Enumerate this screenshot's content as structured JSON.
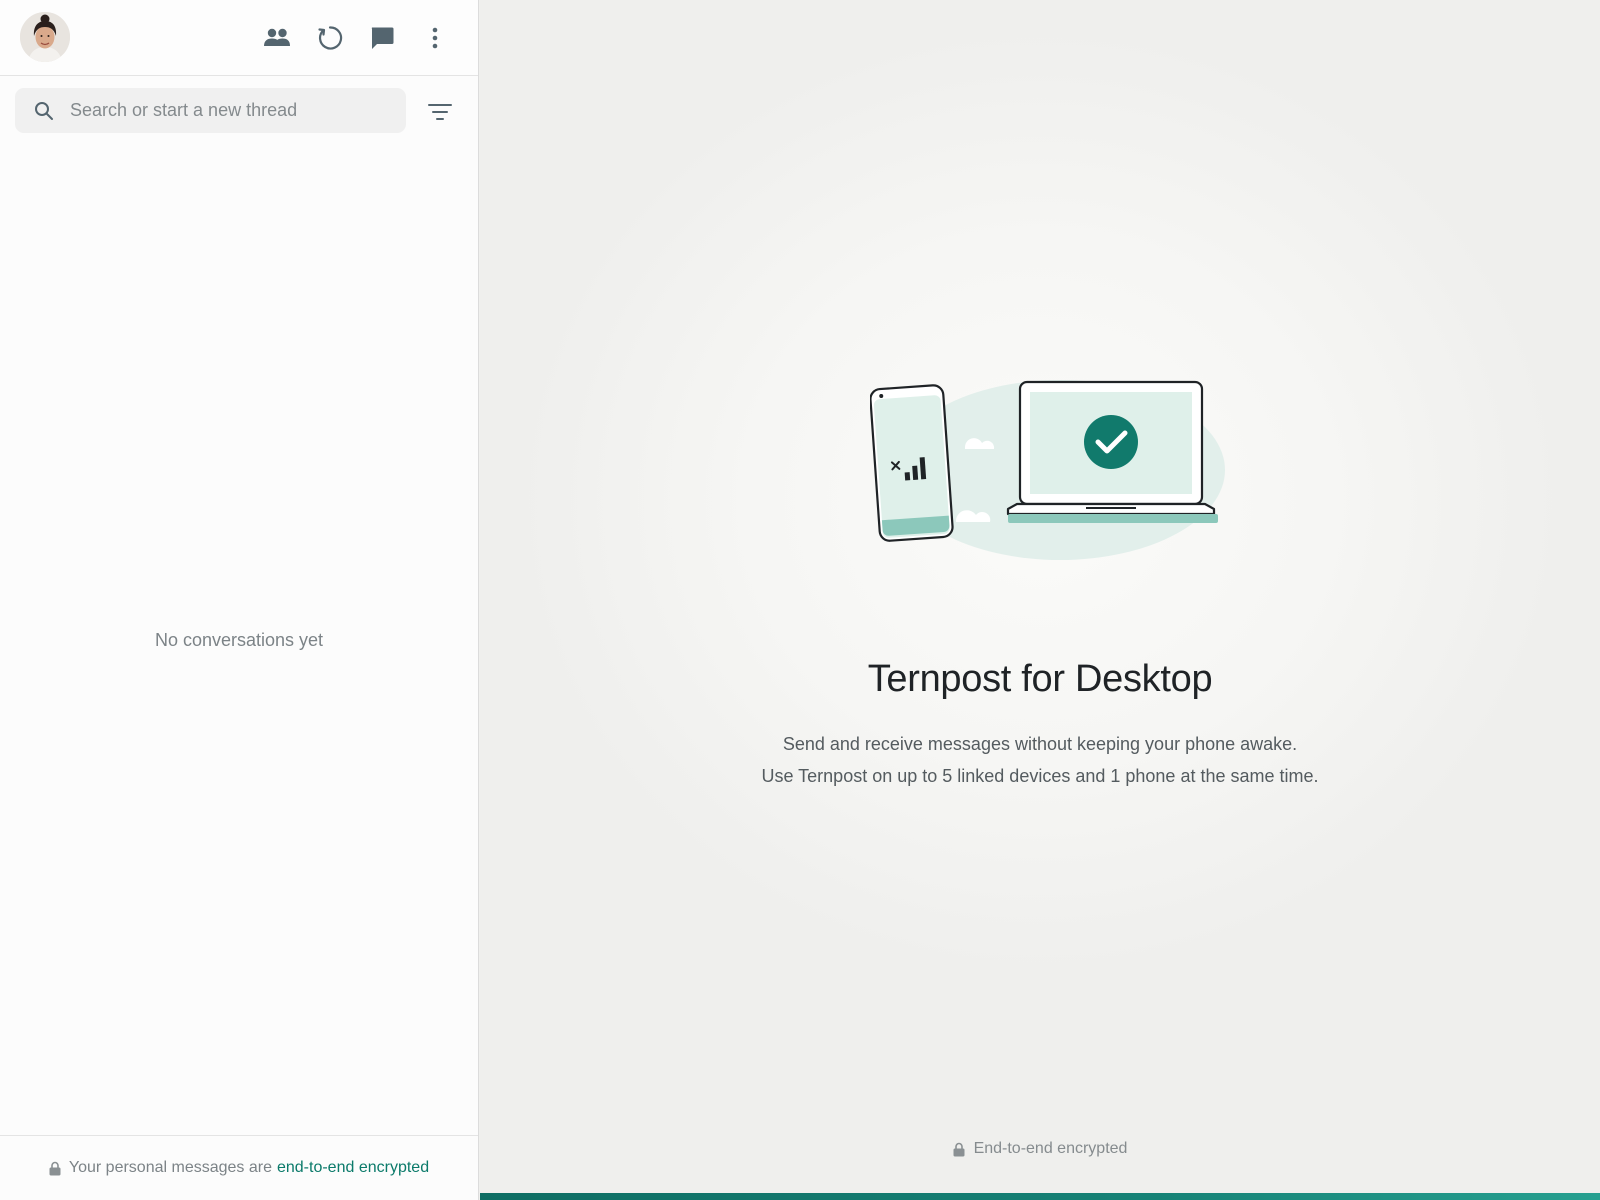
{
  "sidebar": {
    "header": {
      "avatar_icon": "user-avatar",
      "icons": [
        "communities-icon",
        "status-icon",
        "new-chat-icon",
        "menu-icon"
      ]
    },
    "search": {
      "placeholder": "Search or start a new thread",
      "filter_icon": "filter-icon"
    },
    "empty_state": "No conversations yet",
    "footer": {
      "prefix": "Your personal messages are",
      "link": "end-to-end encrypted",
      "icon": "lock-icon"
    }
  },
  "main": {
    "title": "Ternpost for Desktop",
    "description_line1": "Send and receive messages without keeping your phone awake.",
    "description_line2": "Use Ternpost on up to 5 linked devices and 1 phone at the same time.",
    "footer": {
      "text": "End-to-end encrypted",
      "icon": "lock-icon"
    }
  },
  "colors": {
    "accent": "#0b7a6a",
    "check_circle": "#117a6c",
    "bottom_bar": "#0e6d63"
  }
}
